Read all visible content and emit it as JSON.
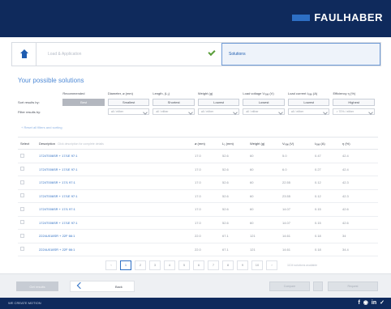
{
  "brand": {
    "name": "FAULHABER"
  },
  "steps": {
    "step1": "Load & Application",
    "step2": "Solutions"
  },
  "panel": {
    "title": "Your possible solutions"
  },
  "filters": {
    "row_labels": {
      "sort": "Sort results by:",
      "filter": "Filter results by:"
    },
    "columns": [
      {
        "header": "Recommended",
        "button": "Best",
        "select": ""
      },
      {
        "header": "Diameter, ø (mm)",
        "button": "Smallest",
        "select": "all / either"
      },
      {
        "header": "Length, (L₁)",
        "button": "Shortest",
        "select": "all / either"
      },
      {
        "header": "Weight (g)",
        "button": "Lowest",
        "select": "all / either"
      },
      {
        "header": "Load voltage Vₗₒₐₑ (V)",
        "button": "Lowest",
        "select": "all / either"
      },
      {
        "header": "Load current Iₗₒₐₑ (A)",
        "button": "Lowest",
        "select": "all / either"
      },
      {
        "header": "Efficiency η (%)",
        "button": "Highest",
        "select": "> 70% / either"
      }
    ],
    "reset": "+ Reset all filters and sorting"
  },
  "table": {
    "headers": {
      "select": "Select",
      "description": "Description",
      "hint": "Click description for complete details",
      "d": "ø (mm)",
      "l": "L₁ (mm)",
      "w": "Weight (g)",
      "v": "Vₗₒₐₑ (V)",
      "i": "Iₗₒₐₑ (A)",
      "e": "η (%)"
    },
    "rows": [
      {
        "desc": "1724T006SR + 17/1E 97:1",
        "d": "17.0",
        "l": "52.6",
        "w": "60",
        "v": "5.0",
        "i": "0.47",
        "e": "42.4"
      },
      {
        "desc": "1724T006SR + 17/1E 97:1",
        "d": "17.0",
        "l": "52.6",
        "w": "60",
        "v": "6.0",
        "i": "0.27",
        "e": "42.4"
      },
      {
        "desc": "1724T006SR + 17/1 97:1",
        "d": "17.0",
        "l": "52.6",
        "w": "60",
        "v": "22.55",
        "i": "0.12",
        "e": "42.3"
      },
      {
        "desc": "1724T006SR + 17/1E 97:1",
        "d": "17.0",
        "l": "52.6",
        "w": "60",
        "v": "23.55",
        "i": "0.12",
        "e": "42.3"
      },
      {
        "desc": "1724T006SR + 17/1 97:1",
        "d": "17.0",
        "l": "52.6",
        "w": "60",
        "v": "14.07",
        "i": "0.15",
        "e": "42.6"
      },
      {
        "desc": "1724T006SR + 17/1E 97:1",
        "d": "17.0",
        "l": "52.6",
        "w": "60",
        "v": "14.07",
        "i": "0.15",
        "e": "42.6"
      },
      {
        "desc": "2224U018SR + 22F 66:1",
        "d": "22.0",
        "l": "67.1",
        "w": "121",
        "v": "14.61",
        "i": "0.18",
        "e": "34"
      },
      {
        "desc": "2224U018SR + 22F 66:1",
        "d": "22.0",
        "l": "67.1",
        "w": "121",
        "v": "14.61",
        "i": "0.18",
        "e": "34.4"
      }
    ]
  },
  "pager": {
    "pages": [
      "1",
      "2",
      "3",
      "4",
      "5",
      "6",
      "7",
      "8",
      "9",
      "10"
    ],
    "prev": "‹",
    "next": "›",
    "note": "1104 solutions available"
  },
  "bottom": {
    "left_button": "Get results",
    "back": "Back",
    "right1": "Compare",
    "right2": "Request"
  },
  "footer": {
    "tagline": "WE CREATE MOTION"
  },
  "colors": {
    "navy": "#0f2a5c",
    "accent": "#2d6fc4",
    "link": "#2f6fc3"
  }
}
